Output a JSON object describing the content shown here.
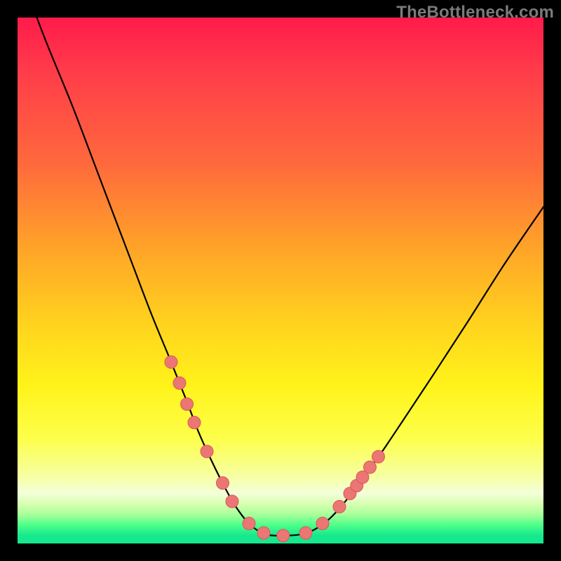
{
  "watermark": "TheBottleneck.com",
  "colors": {
    "frame": "#000000",
    "curve": "#000000",
    "dot_fill": "#eb7674",
    "dot_stroke": "#d85a58",
    "gradient_stops": [
      {
        "y": 0.0,
        "color": "#ff1b4a"
      },
      {
        "y": 0.1,
        "color": "#ff3b4a"
      },
      {
        "y": 0.28,
        "color": "#ff6a3c"
      },
      {
        "y": 0.44,
        "color": "#ffa428"
      },
      {
        "y": 0.58,
        "color": "#ffd21e"
      },
      {
        "y": 0.7,
        "color": "#fff31a"
      },
      {
        "y": 0.8,
        "color": "#fdff4a"
      },
      {
        "y": 0.87,
        "color": "#f6ffa0"
      },
      {
        "y": 0.905,
        "color": "#f3ffda"
      },
      {
        "y": 0.925,
        "color": "#d7ffb0"
      },
      {
        "y": 0.945,
        "color": "#a8ff9a"
      },
      {
        "y": 0.965,
        "color": "#4dff8a"
      },
      {
        "y": 0.985,
        "color": "#16e88e"
      },
      {
        "y": 1.0,
        "color": "#16e88e"
      }
    ]
  },
  "chart_data": {
    "type": "line",
    "title": "",
    "xlabel": "",
    "ylabel": "",
    "xlim": [
      0,
      1
    ],
    "ylim": [
      0,
      1
    ],
    "note": "Coordinates are normalized to the 750×750 plot area. y=0 is top, y=1 is bottom. The curve is a V-shaped bottleneck profile; the background vertical gradient encodes severity (red=high, green=low).",
    "series": [
      {
        "name": "bottleneck-curve",
        "x": [
          0.0,
          0.05,
          0.105,
          0.16,
          0.215,
          0.255,
          0.29,
          0.32,
          0.345,
          0.37,
          0.395,
          0.415,
          0.44,
          0.47,
          0.51,
          0.55,
          0.585,
          0.615,
          0.65,
          0.69,
          0.735,
          0.79,
          0.855,
          0.925,
          1.0
        ],
        "y": [
          -0.1,
          0.035,
          0.17,
          0.315,
          0.46,
          0.565,
          0.65,
          0.725,
          0.79,
          0.845,
          0.895,
          0.93,
          0.962,
          0.982,
          0.985,
          0.98,
          0.96,
          0.93,
          0.885,
          0.83,
          0.763,
          0.68,
          0.58,
          0.47,
          0.36
        ]
      }
    ],
    "dots": {
      "name": "highlighted-points",
      "x": [
        0.292,
        0.308,
        0.322,
        0.336,
        0.36,
        0.39,
        0.408,
        0.44,
        0.468,
        0.505,
        0.548,
        0.58,
        0.612,
        0.632,
        0.645,
        0.656,
        0.67,
        0.686
      ],
      "y": [
        0.655,
        0.695,
        0.735,
        0.77,
        0.825,
        0.885,
        0.92,
        0.962,
        0.98,
        0.985,
        0.98,
        0.962,
        0.93,
        0.905,
        0.89,
        0.874,
        0.855,
        0.835
      ],
      "r": 9
    }
  }
}
